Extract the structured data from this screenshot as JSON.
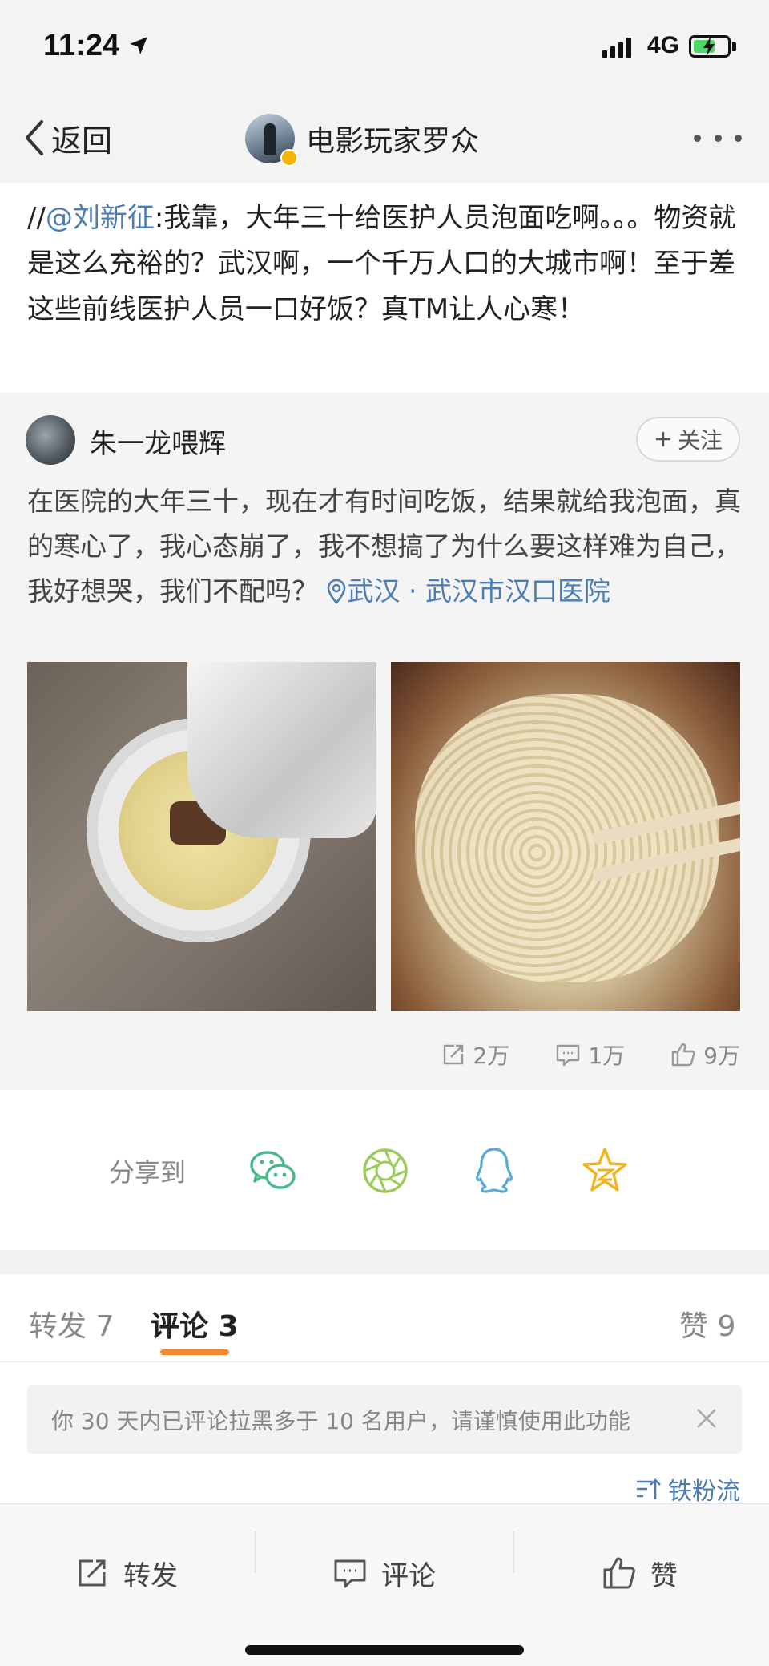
{
  "status_bar": {
    "time": "11:24",
    "network": "4G"
  },
  "nav": {
    "back_label": "返回",
    "title": "电影玩家罗众"
  },
  "repost": {
    "prefix": "//",
    "mention": "@刘新征",
    "text": ":我靠，大年三十给医护人员泡面吃啊。。。物资就是这么充裕的？武汉啊，一个千万人口的大城市啊！至于差这些前线医护人员一口好饭？真TM让人心寒！"
  },
  "original_post": {
    "author": "朱一龙喂辉",
    "follow_label": "关注",
    "text": "在医院的大年三十，现在才有时间吃饭，结果就给我泡面，真的寒心了，我心态崩了，我不想搞了为什么要这样难为自己，我好想哭，我们不配吗？",
    "location": "武汉 · 武汉市汉口医院",
    "stats": {
      "reposts": "2万",
      "comments": "1万",
      "likes": "9万"
    }
  },
  "share": {
    "label": "分享到",
    "targets": [
      "wechat-icon",
      "moments-icon",
      "qq-icon",
      "qzone-star-icon"
    ],
    "colors": {
      "wechat": "#4bb88a",
      "moments": "#9ccb5a",
      "qq": "#5aa9d6",
      "star": "#f2b41c"
    }
  },
  "tabs": {
    "repost": {
      "label": "转发",
      "count": "7"
    },
    "comment": {
      "label": "评论",
      "count": "3"
    },
    "like": {
      "label": "赞",
      "count": "9"
    },
    "accent_color": "#f28a30"
  },
  "notice": {
    "text": "你 30 天内已评论拉黑多于 10 名用户，请谨慎使用此功能"
  },
  "sort": {
    "label": "铁粉流"
  },
  "bottom_bar": {
    "repost": "转发",
    "comment": "评论",
    "like": "赞"
  },
  "link_color": "#4a7cb5"
}
